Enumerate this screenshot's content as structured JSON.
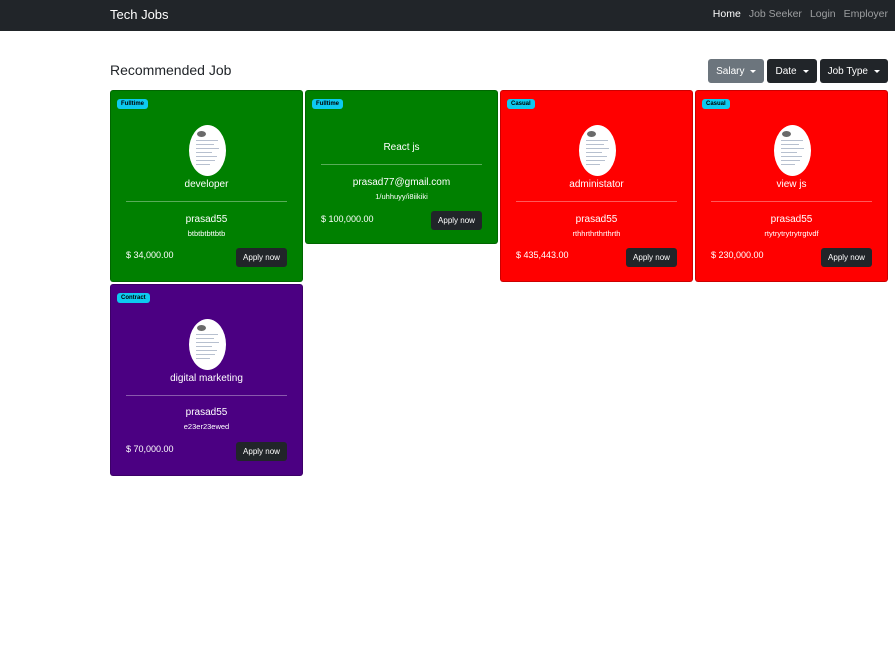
{
  "navbar": {
    "brand": "Tech Jobs",
    "links": [
      "Home",
      "Job Seeker",
      "Login",
      "Employer"
    ]
  },
  "page": {
    "title": "Recommended Job",
    "filters": [
      "Salary",
      "Date",
      "Job Type"
    ]
  },
  "jobs": [
    {
      "badge": "Fulltime",
      "title": "developer",
      "company": "prasad55",
      "detail": "btbtbtbttbtb",
      "salary": "$ 34,000.00",
      "apply": "Apply now",
      "bg": "#008000"
    },
    {
      "badge": "Fulltime",
      "title": "React js",
      "company": "prasad77@gmail.com",
      "detail": "1/uhhuyy/i8iikiki",
      "salary": "$ 100,000.00",
      "apply": "Apply now",
      "bg": "#008000"
    },
    {
      "badge": "Casual",
      "title": "administator",
      "company": "prasad55",
      "detail": "rthhrthrthrthrth",
      "salary": "$ 435,443.00",
      "apply": "Apply now",
      "bg": "#ff0000"
    },
    {
      "badge": "Casual",
      "title": "view js",
      "company": "prasad55",
      "detail": "rtytrytrytrytrgtvdf",
      "salary": "$ 230,000.00",
      "apply": "Apply now",
      "bg": "#ff0000"
    },
    {
      "badge": "Contract",
      "title": "digital marketing",
      "company": "prasad55",
      "detail": "e23er23ewed",
      "salary": "$ 70,000.00",
      "apply": "Apply now",
      "bg": "#4b0082"
    }
  ]
}
